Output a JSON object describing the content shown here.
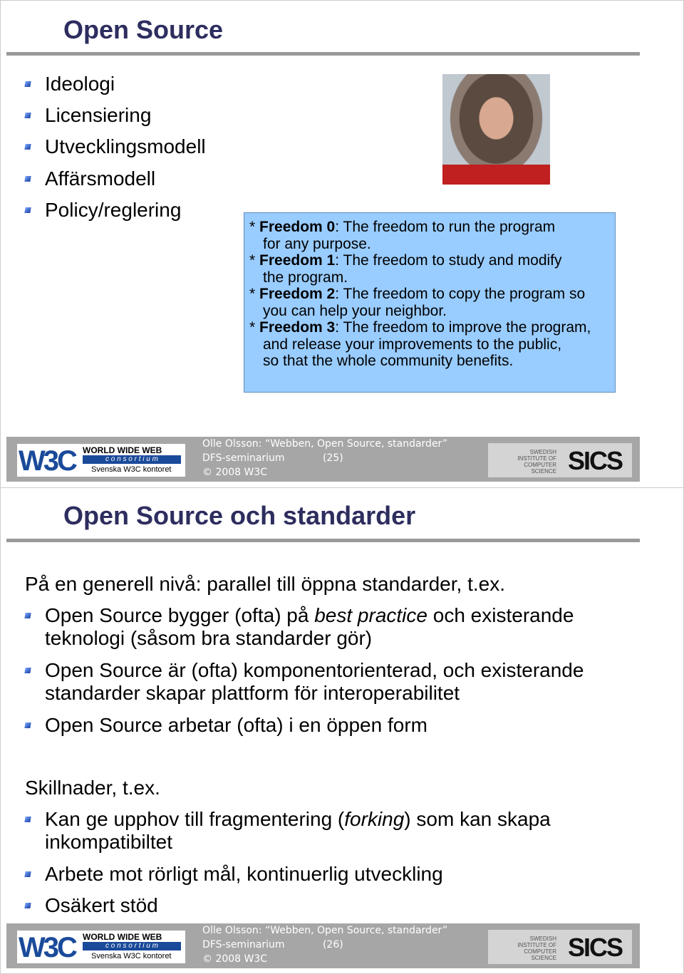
{
  "slides": [
    {
      "title": "Open Source",
      "bullets": [
        "Ideologi",
        "Licensiering",
        "Utvecklingsmodell",
        "Affärsmodell",
        "Policy/reglering"
      ],
      "freedoms": [
        {
          "prefix": "* ",
          "label": "Freedom 0",
          "text": ": The freedom to run the program",
          "cont": [
            "for any purpose."
          ]
        },
        {
          "prefix": "* ",
          "label": "Freedom 1",
          "text": ": The freedom to study and modify",
          "cont": [
            "the program."
          ]
        },
        {
          "prefix": "* ",
          "label": "Freedom 2",
          "text": ": The freedom to copy the program so",
          "cont": [
            "you can help your neighbor."
          ]
        },
        {
          "prefix": "* ",
          "label": "Freedom 3",
          "text": ": The freedom to improve the program,",
          "cont": [
            "and release your improvements to the public,",
            "so that the whole community benefits."
          ]
        }
      ],
      "footer": {
        "line1": "Olle Olsson: “Webben, Open Source, standarder”",
        "line2": "DFS-seminarium            (25)",
        "line3": "© 2008 W3C"
      }
    },
    {
      "title": "Open Source och standarder",
      "intro": "På en generell nivå: parallel till öppna standarder, t.ex.",
      "b1a": "Open Source bygger (ofta) på ",
      "b1em": "best practice",
      "b1b": " och existerande",
      "b1c": "teknologi (såsom bra standarder gör)",
      "b2a": "Open Source är (ofta) komponentorienterad, och existerande",
      "b2b": "standarder skapar plattform för interoperabilitet",
      "b3": "Open Source arbetar (ofta) i en öppen form",
      "intro2": "Skillnader, t.ex.",
      "b4a": "Kan ge upphov till fragmentering (",
      "b4em": "forking",
      "b4b": ") som kan skapa",
      "b4c": "inkompatibiltet",
      "b5": "Arbete mot rörligt mål, kontinuerlig utveckling",
      "b6": "Osäkert stöd",
      "footer": {
        "line1": "Olle Olsson: “Webben, Open Source, standarder”",
        "line2": "DFS-seminarium            (26)",
        "line3": "© 2008 W3C"
      }
    }
  ],
  "logos": {
    "w3c": "W3C",
    "www": "WORLD WIDE WEB",
    "consortium": "c o n s o r t i u m",
    "kontor": "Svenska W3C kontoret",
    "sics_small": "SWEDISH INSTITUTE OF COMPUTER SCIENCE",
    "sics": "SICS"
  },
  "colors": {
    "title": "#2d2d5f",
    "box": "#99ccff",
    "footer": "#a6a6a6"
  }
}
